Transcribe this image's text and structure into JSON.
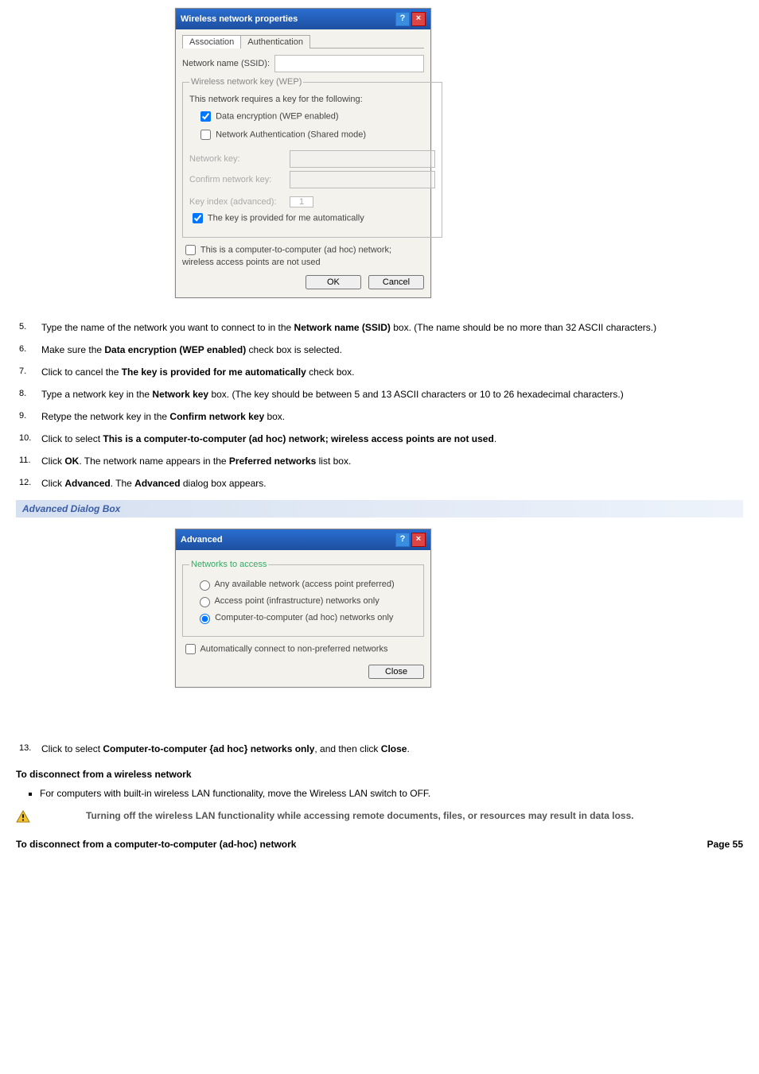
{
  "dialog1": {
    "title": "Wireless network properties",
    "tab_association": "Association",
    "tab_authentication": "Authentication",
    "ssid_label": "Network name (SSID):",
    "wep_legend": "Wireless network key (WEP)",
    "wep_caption": "This network requires a key for the following:",
    "chk_data_encryption": "Data encryption (WEP enabled)",
    "chk_net_auth": "Network Authentication (Shared mode)",
    "netkey_label": "Network key:",
    "confirm_label": "Confirm network key:",
    "keyindex_label": "Key index (advanced):",
    "keyindex_value": "1",
    "chk_auto_key": "The key is provided for me automatically",
    "chk_adhoc": "This is a computer-to-computer (ad hoc) network; wireless access points are not used",
    "btn_ok": "OK",
    "btn_cancel": "Cancel"
  },
  "steps1": [
    {
      "n": "5.",
      "html": "Type the name of the network you want to connect to in the <b>Network name (SSID)</b> box. (The name should be no more than 32 ASCII characters.)"
    },
    {
      "n": "6.",
      "html": "Make sure the <b>Data encryption (WEP enabled)</b> check box is selected."
    },
    {
      "n": "7.",
      "html": "Click to cancel the <b>The key is provided for me automatically</b> check box."
    },
    {
      "n": "8.",
      "html": "Type a network key in the <b>Network key</b> box. (The key should be between 5 and 13 ASCII characters or 10 to 26 hexadecimal characters.)"
    },
    {
      "n": "9.",
      "html": "Retype the network key in the <b>Confirm network key</b> box."
    },
    {
      "n": "10.",
      "html": "Click to select <b>This is a computer-to-computer (ad hoc) network; wireless access points are not used</b>."
    },
    {
      "n": "11.",
      "html": "Click <b>OK</b>. The network name appears in the <b>Preferred networks</b> list box."
    },
    {
      "n": "12.",
      "html": "Click <b>Advanced</b>. The <b>Advanced</b> dialog box appears."
    }
  ],
  "section_header": "Advanced Dialog Box",
  "dialog2": {
    "title": "Advanced",
    "legend": "Networks to access",
    "opt1": "Any available network (access point preferred)",
    "opt2": "Access point (infrastructure) networks only",
    "opt3": "Computer-to-computer (ad hoc) networks only",
    "chk_auto_connect": "Automatically connect to non-preferred networks",
    "btn_close": "Close"
  },
  "steps2": [
    {
      "n": "13.",
      "html": "Click to select <b>Computer-to-computer {ad hoc} networks only</b>, and then click <b>Close</b>."
    }
  ],
  "subheading_disconnect": "To disconnect from a wireless network",
  "bullet_disconnect": "For computers with built-in wireless LAN functionality, move the Wireless LAN switch to OFF.",
  "warning_text": "Turning off the wireless LAN functionality while accessing remote documents, files, or resources may result in data loss.",
  "footer_left": "To disconnect from a computer-to-computer (ad-hoc) network",
  "footer_right": "Page 55"
}
